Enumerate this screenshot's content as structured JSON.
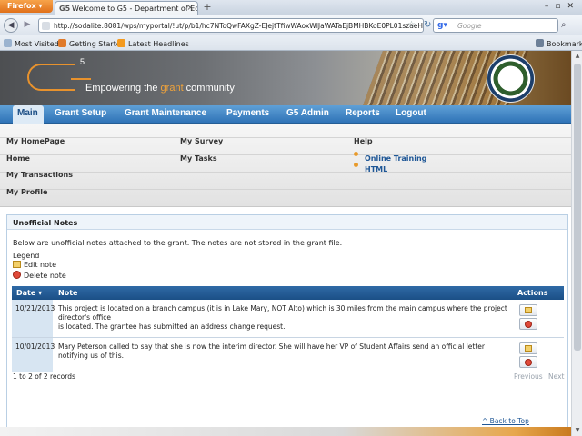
{
  "browser": {
    "menu_button": "Firefox",
    "tab_title": "Welcome to G5 - Department of Educatio...",
    "tab_favicon": "G5",
    "url": "http://sodalite:8081/wps/myportal/!ut/p/b1/hc7NToQwFAXgZ-EJejtTfiwWAoxWIJaWATaEjBMHBKoE0PL01szaeHc",
    "search_placeholder": "Google",
    "bookmarks_bar_label": "Bookmarks",
    "bookmarks": [
      "Most Visited",
      "Getting Started",
      "Latest Headlines"
    ]
  },
  "banner": {
    "logo_superscript": "5",
    "tagline_pre": "Empowering the ",
    "tagline_accent": "grant",
    "tagline_post": " community"
  },
  "main_nav": [
    "Main",
    "Grant Setup",
    "Grant Maintenance",
    "Payments",
    "G5 Admin",
    "Reports",
    "Logout"
  ],
  "submenu": {
    "col1": [
      "My HomePage",
      "Home",
      "My Transactions",
      "My Profile"
    ],
    "col2": [
      "My Survey",
      "My Tasks"
    ],
    "help_title": "Help",
    "help_links": [
      "Online Training",
      "HTML"
    ]
  },
  "notes": {
    "title": "Unofficial Notes",
    "intro": "Below are unofficial notes attached to the grant. The notes are not stored in the grant file.",
    "legend_title": "Legend",
    "legend_edit": "Edit note",
    "legend_delete": "Delete note",
    "columns": {
      "date": "Date",
      "note": "Note",
      "actions": "Actions"
    },
    "rows": [
      {
        "date": "10/21/2013",
        "note_line1": "This project is located on a branch campus (it is in Lake Mary, NOT Alto) which is 30 miles from the main campus where the project director's office",
        "note_line2": "is located.  The grantee has submitted an address change request."
      },
      {
        "date": "10/01/2013",
        "note_line1": "Mary Peterson called to say that she is now the interim director.  She will have her VP of Student Affairs send an official letter notifying us of this.",
        "note_line2": ""
      }
    ],
    "records": "1 to 2 of 2 records",
    "pager_prev": "Previous",
    "pager_next": "Next"
  },
  "back_to_top": "^ Back to Top"
}
